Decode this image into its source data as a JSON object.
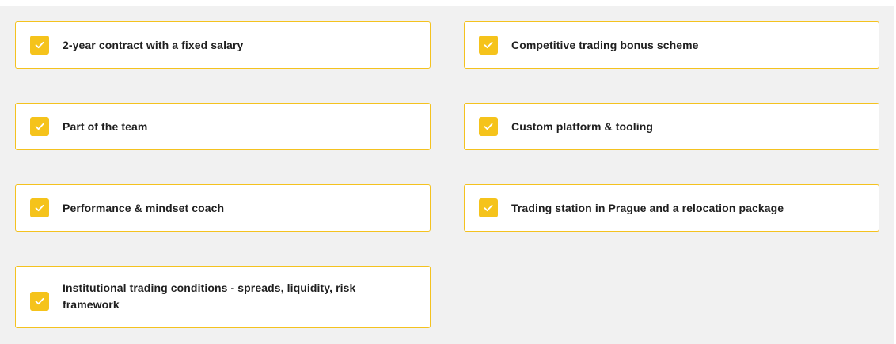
{
  "benefits": {
    "icon": "check-icon",
    "accent_color": "#f5c31b",
    "border_color": "#f4c21f",
    "items": [
      {
        "label": "2-year contract with a fixed salary"
      },
      {
        "label": "Competitive trading bonus scheme"
      },
      {
        "label": "Part of the team"
      },
      {
        "label": "Custom platform & tooling"
      },
      {
        "label": "Performance & mindset coach"
      },
      {
        "label": "Trading station in Prague and a relocation package"
      },
      {
        "label": "Institutional trading conditions - spreads, liquidity, risk framework"
      }
    ]
  }
}
